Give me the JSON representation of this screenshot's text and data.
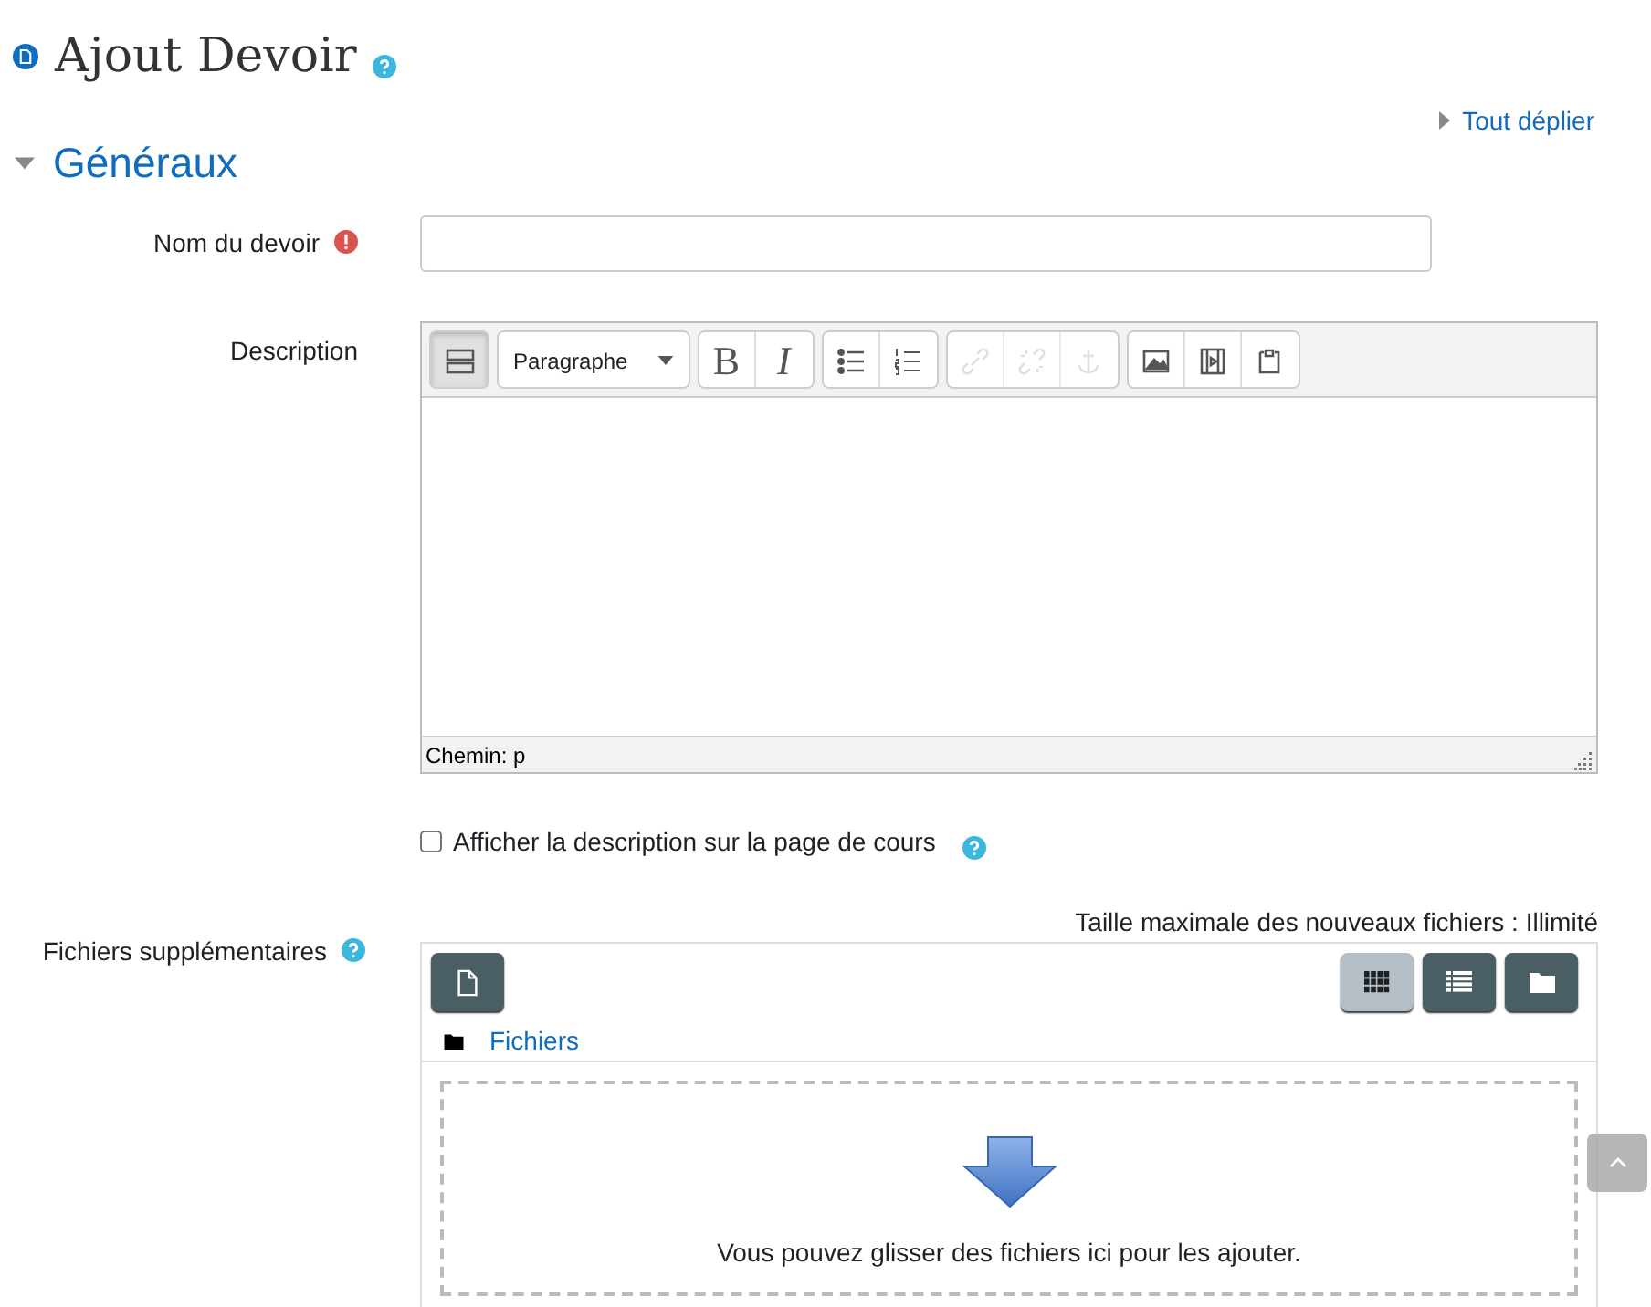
{
  "page": {
    "title": "Ajout Devoir"
  },
  "expand_all": "Tout déplier",
  "section": {
    "title": "Généraux",
    "expanded": true
  },
  "name_field": {
    "label": "Nom du devoir",
    "required": true
  },
  "description": {
    "label": "Description",
    "format": "Paragraphe",
    "toolbar": [
      [
        {
          "kind": "more",
          "disabled": false,
          "pressed": true
        }
      ],
      [
        {
          "kind": "format"
        }
      ],
      [
        {
          "kind": "bold",
          "label": "B",
          "disabled": false,
          "pressed": false
        },
        {
          "kind": "italic",
          "label": "I",
          "disabled": false,
          "pressed": false
        }
      ],
      [
        {
          "kind": "bullets",
          "disabled": false,
          "pressed": false
        },
        {
          "kind": "numbers",
          "disabled": false,
          "pressed": false
        }
      ],
      [
        {
          "kind": "link",
          "disabled": true,
          "pressed": false
        },
        {
          "kind": "unlink",
          "disabled": true,
          "pressed": false
        },
        {
          "kind": "anchor",
          "disabled": true,
          "pressed": false
        }
      ],
      [
        {
          "kind": "image",
          "disabled": false,
          "pressed": false
        },
        {
          "kind": "media",
          "disabled": false,
          "pressed": false
        },
        {
          "kind": "paste",
          "disabled": false,
          "pressed": false
        }
      ]
    ],
    "path": "Chemin: p"
  },
  "show_description": {
    "label": "Afficher la description sur la page de cours",
    "checked": false
  },
  "files": {
    "label": "Fichiers supplémentaires",
    "max_size": "Taille maximale des nouveaux fichiers : Illimité",
    "views": [
      {
        "kind": "icons",
        "selected": true
      },
      {
        "kind": "list",
        "selected": false
      },
      {
        "kind": "tree",
        "selected": false
      }
    ],
    "folder": "Fichiers",
    "drop_hint": "Vous pouvez glisser des fichiers ici pour les ajouter."
  }
}
